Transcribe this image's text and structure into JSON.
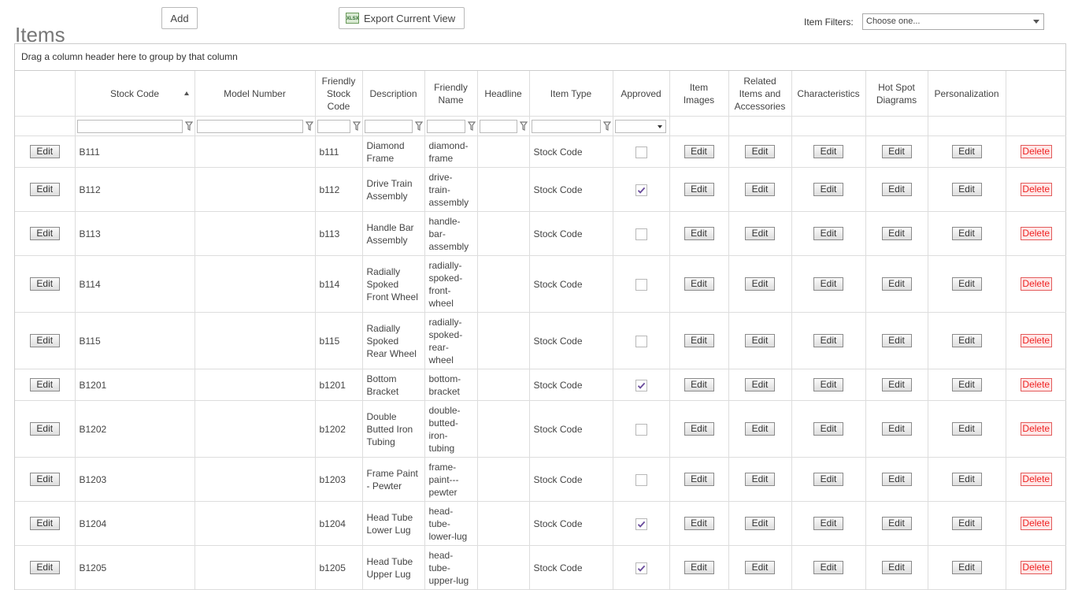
{
  "page": {
    "title": "Items",
    "add_label": "Add",
    "export_label": "Export Current View",
    "export_icon": "excel-xls-icon",
    "export_icon_text": "XLSX",
    "filters_label": "Item Filters:",
    "filters_value": "Choose one..."
  },
  "grid": {
    "group_hint": "Drag a column header here to group by that column",
    "headers": {
      "stock_code": "Stock Code",
      "model_number": "Model Number",
      "friendly_stock_code": "Friendly Stock Code",
      "description": "Description",
      "friendly_name": "Friendly Name",
      "headline": "Headline",
      "item_type": "Item Type",
      "approved": "Approved",
      "item_images": "Item Images",
      "related": "Related Items and Accessories",
      "characteristics": "Characteristics",
      "hot_spot": "Hot Spot Diagrams",
      "personalization": "Personalization"
    },
    "sort": {
      "column": "stock_code",
      "direction": "ascending"
    },
    "edit_label": "Edit",
    "delete_label": "Delete",
    "rows": [
      {
        "stock_code": "B111",
        "friendly_stock_code": "b111",
        "description": "Diamond Frame",
        "friendly_name": "diamond-frame",
        "item_type": "Stock Code",
        "approved": false
      },
      {
        "stock_code": "B112",
        "friendly_stock_code": "b112",
        "description": "Drive Train Assembly",
        "friendly_name": "drive-train-assembly",
        "item_type": "Stock Code",
        "approved": true
      },
      {
        "stock_code": "B113",
        "friendly_stock_code": "b113",
        "description": "Handle Bar Assembly",
        "friendly_name": "handle-bar-assembly",
        "item_type": "Stock Code",
        "approved": false
      },
      {
        "stock_code": "B114",
        "friendly_stock_code": "b114",
        "description": "Radially Spoked Front Wheel",
        "friendly_name": "radially-spoked-front-wheel",
        "item_type": "Stock Code",
        "approved": false
      },
      {
        "stock_code": "B115",
        "friendly_stock_code": "b115",
        "description": "Radially Spoked Rear Wheel",
        "friendly_name": "radially-spoked-rear-wheel",
        "item_type": "Stock Code",
        "approved": false
      },
      {
        "stock_code": "B1201",
        "friendly_stock_code": "b1201",
        "description": "Bottom Bracket",
        "friendly_name": "bottom-bracket",
        "item_type": "Stock Code",
        "approved": true
      },
      {
        "stock_code": "B1202",
        "friendly_stock_code": "b1202",
        "description": "Double Butted Iron Tubing",
        "friendly_name": "double-butted-iron-tubing",
        "item_type": "Stock Code",
        "approved": false
      },
      {
        "stock_code": "B1203",
        "friendly_stock_code": "b1203",
        "description": "Frame Paint - Pewter",
        "friendly_name": "frame-paint---pewter",
        "item_type": "Stock Code",
        "approved": false
      },
      {
        "stock_code": "B1204",
        "friendly_stock_code": "b1204",
        "description": "Head Tube Lower Lug",
        "friendly_name": "head-tube-lower-lug",
        "item_type": "Stock Code",
        "approved": true
      },
      {
        "stock_code": "B1205",
        "friendly_stock_code": "b1205",
        "description": "Head Tube Upper Lug",
        "friendly_name": "head-tube-upper-lug",
        "item_type": "Stock Code",
        "approved": true
      }
    ]
  },
  "colors": {
    "delete": "#e22222",
    "check": "#6a4c9c"
  }
}
